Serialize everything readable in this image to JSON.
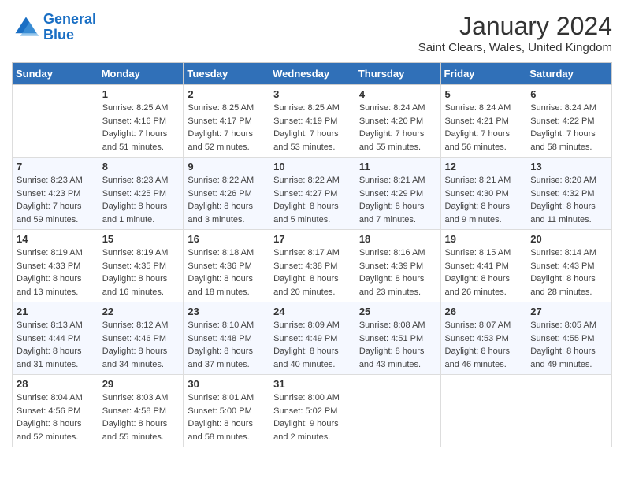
{
  "header": {
    "logo_line1": "General",
    "logo_line2": "Blue",
    "month": "January 2024",
    "location": "Saint Clears, Wales, United Kingdom"
  },
  "days_of_week": [
    "Sunday",
    "Monday",
    "Tuesday",
    "Wednesday",
    "Thursday",
    "Friday",
    "Saturday"
  ],
  "weeks": [
    [
      {
        "day": "",
        "info": ""
      },
      {
        "day": "1",
        "info": "Sunrise: 8:25 AM\nSunset: 4:16 PM\nDaylight: 7 hours\nand 51 minutes."
      },
      {
        "day": "2",
        "info": "Sunrise: 8:25 AM\nSunset: 4:17 PM\nDaylight: 7 hours\nand 52 minutes."
      },
      {
        "day": "3",
        "info": "Sunrise: 8:25 AM\nSunset: 4:19 PM\nDaylight: 7 hours\nand 53 minutes."
      },
      {
        "day": "4",
        "info": "Sunrise: 8:24 AM\nSunset: 4:20 PM\nDaylight: 7 hours\nand 55 minutes."
      },
      {
        "day": "5",
        "info": "Sunrise: 8:24 AM\nSunset: 4:21 PM\nDaylight: 7 hours\nand 56 minutes."
      },
      {
        "day": "6",
        "info": "Sunrise: 8:24 AM\nSunset: 4:22 PM\nDaylight: 7 hours\nand 58 minutes."
      }
    ],
    [
      {
        "day": "7",
        "info": "Sunrise: 8:23 AM\nSunset: 4:23 PM\nDaylight: 7 hours\nand 59 minutes."
      },
      {
        "day": "8",
        "info": "Sunrise: 8:23 AM\nSunset: 4:25 PM\nDaylight: 8 hours\nand 1 minute."
      },
      {
        "day": "9",
        "info": "Sunrise: 8:22 AM\nSunset: 4:26 PM\nDaylight: 8 hours\nand 3 minutes."
      },
      {
        "day": "10",
        "info": "Sunrise: 8:22 AM\nSunset: 4:27 PM\nDaylight: 8 hours\nand 5 minutes."
      },
      {
        "day": "11",
        "info": "Sunrise: 8:21 AM\nSunset: 4:29 PM\nDaylight: 8 hours\nand 7 minutes."
      },
      {
        "day": "12",
        "info": "Sunrise: 8:21 AM\nSunset: 4:30 PM\nDaylight: 8 hours\nand 9 minutes."
      },
      {
        "day": "13",
        "info": "Sunrise: 8:20 AM\nSunset: 4:32 PM\nDaylight: 8 hours\nand 11 minutes."
      }
    ],
    [
      {
        "day": "14",
        "info": "Sunrise: 8:19 AM\nSunset: 4:33 PM\nDaylight: 8 hours\nand 13 minutes."
      },
      {
        "day": "15",
        "info": "Sunrise: 8:19 AM\nSunset: 4:35 PM\nDaylight: 8 hours\nand 16 minutes."
      },
      {
        "day": "16",
        "info": "Sunrise: 8:18 AM\nSunset: 4:36 PM\nDaylight: 8 hours\nand 18 minutes."
      },
      {
        "day": "17",
        "info": "Sunrise: 8:17 AM\nSunset: 4:38 PM\nDaylight: 8 hours\nand 20 minutes."
      },
      {
        "day": "18",
        "info": "Sunrise: 8:16 AM\nSunset: 4:39 PM\nDaylight: 8 hours\nand 23 minutes."
      },
      {
        "day": "19",
        "info": "Sunrise: 8:15 AM\nSunset: 4:41 PM\nDaylight: 8 hours\nand 26 minutes."
      },
      {
        "day": "20",
        "info": "Sunrise: 8:14 AM\nSunset: 4:43 PM\nDaylight: 8 hours\nand 28 minutes."
      }
    ],
    [
      {
        "day": "21",
        "info": "Sunrise: 8:13 AM\nSunset: 4:44 PM\nDaylight: 8 hours\nand 31 minutes."
      },
      {
        "day": "22",
        "info": "Sunrise: 8:12 AM\nSunset: 4:46 PM\nDaylight: 8 hours\nand 34 minutes."
      },
      {
        "day": "23",
        "info": "Sunrise: 8:10 AM\nSunset: 4:48 PM\nDaylight: 8 hours\nand 37 minutes."
      },
      {
        "day": "24",
        "info": "Sunrise: 8:09 AM\nSunset: 4:49 PM\nDaylight: 8 hours\nand 40 minutes."
      },
      {
        "day": "25",
        "info": "Sunrise: 8:08 AM\nSunset: 4:51 PM\nDaylight: 8 hours\nand 43 minutes."
      },
      {
        "day": "26",
        "info": "Sunrise: 8:07 AM\nSunset: 4:53 PM\nDaylight: 8 hours\nand 46 minutes."
      },
      {
        "day": "27",
        "info": "Sunrise: 8:05 AM\nSunset: 4:55 PM\nDaylight: 8 hours\nand 49 minutes."
      }
    ],
    [
      {
        "day": "28",
        "info": "Sunrise: 8:04 AM\nSunset: 4:56 PM\nDaylight: 8 hours\nand 52 minutes."
      },
      {
        "day": "29",
        "info": "Sunrise: 8:03 AM\nSunset: 4:58 PM\nDaylight: 8 hours\nand 55 minutes."
      },
      {
        "day": "30",
        "info": "Sunrise: 8:01 AM\nSunset: 5:00 PM\nDaylight: 8 hours\nand 58 minutes."
      },
      {
        "day": "31",
        "info": "Sunrise: 8:00 AM\nSunset: 5:02 PM\nDaylight: 9 hours\nand 2 minutes."
      },
      {
        "day": "",
        "info": ""
      },
      {
        "day": "",
        "info": ""
      },
      {
        "day": "",
        "info": ""
      }
    ]
  ]
}
